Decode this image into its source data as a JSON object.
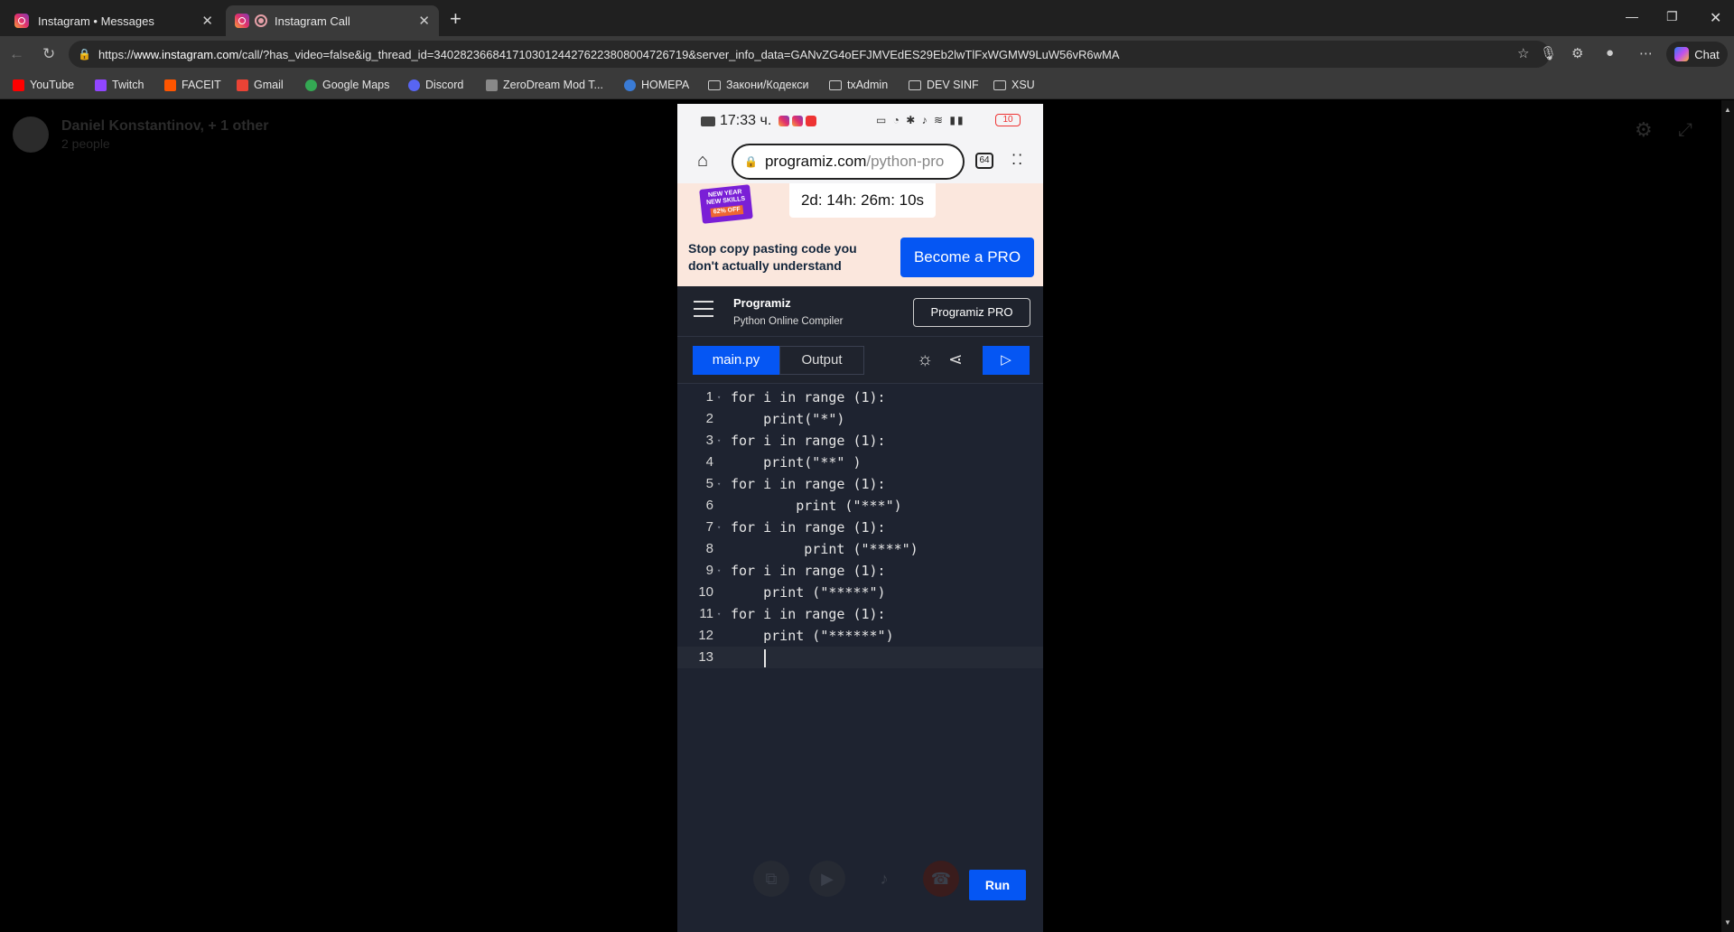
{
  "browser": {
    "tabs": [
      {
        "title": "Instagram • Messages",
        "active": false
      },
      {
        "title": "Instagram Call",
        "active": true
      }
    ],
    "url_prefix": "https://",
    "url_domain": "www.instagram.com",
    "url_rest": "/call/?has_video=false&ig_thread_id=340282366841710301244276223808004726719&server_info_data=GANvZG4oEFJMVEdES29Eb2lwTlFxWGMW9LuW56vR6wMA",
    "chat_label": "Chat",
    "bookmarks": [
      {
        "label": "YouTube",
        "icon": "youtube-icon",
        "color": "#ff0000"
      },
      {
        "label": "Twitch",
        "icon": "twitch-icon",
        "color": "#9146ff"
      },
      {
        "label": "FACEIT",
        "icon": "faceit-icon",
        "color": "#ff5500"
      },
      {
        "label": "Gmail",
        "icon": "gmail-icon",
        "color": "#ea4335"
      },
      {
        "label": "Google Maps",
        "icon": "maps-icon",
        "color": "#34a853"
      },
      {
        "label": "Discord",
        "icon": "discord-icon",
        "color": "#5865f2"
      },
      {
        "label": "ZeroDream Mod T...",
        "icon": "zerodream-icon",
        "color": "#888888"
      },
      {
        "label": "HOMEPA",
        "icon": "homepa-icon",
        "color": "#3a7bd5"
      },
      {
        "label": "Закони/Кодекси",
        "icon": "folder-icon",
        "color": ""
      },
      {
        "label": "txAdmin",
        "icon": "folder-icon",
        "color": ""
      },
      {
        "label": "DEV SINF",
        "icon": "folder-icon",
        "color": ""
      },
      {
        "label": "XSU",
        "icon": "folder-icon",
        "color": ""
      }
    ]
  },
  "call": {
    "caller_name": "Daniel Konstantinov, + 1 other",
    "people_count": "2 people"
  },
  "phone": {
    "time": "17:33 ч.",
    "battery": "10",
    "url_domain": "programiz.com",
    "url_path": "/python-pro",
    "tabs_count": "64",
    "promo": {
      "badge_line1": "NEW YEAR",
      "badge_line2": "NEW SKILLS",
      "badge_off": "62% OFF",
      "countdown": "2d: 14h: 26m: 10s",
      "text": "Stop copy pasting code you don't actually understand",
      "button": "Become a PRO"
    },
    "header": {
      "logo": "Programiz",
      "subtitle": "Python Online Compiler",
      "pro_button": "Programiz PRO"
    },
    "toolbar": {
      "tab_main": "main.py",
      "tab_output": "Output"
    },
    "code_lines": [
      "for i in range (1):",
      "    print(\"*\")",
      "for i in range (1):",
      "    print(\"**\" )",
      "for i in range (1):",
      "        print (\"***\")",
      "for i in range (1):",
      "         print (\"****\")",
      "for i in range (1):",
      "    print (\"*****\")",
      "for i in range (1):",
      "    print (\"******\")",
      ""
    ],
    "run_button": "Run"
  },
  "colors": {
    "accent_blue": "#0556f3",
    "editor_bg": "#1e2330",
    "promo_bg": "#fbe7dd"
  }
}
